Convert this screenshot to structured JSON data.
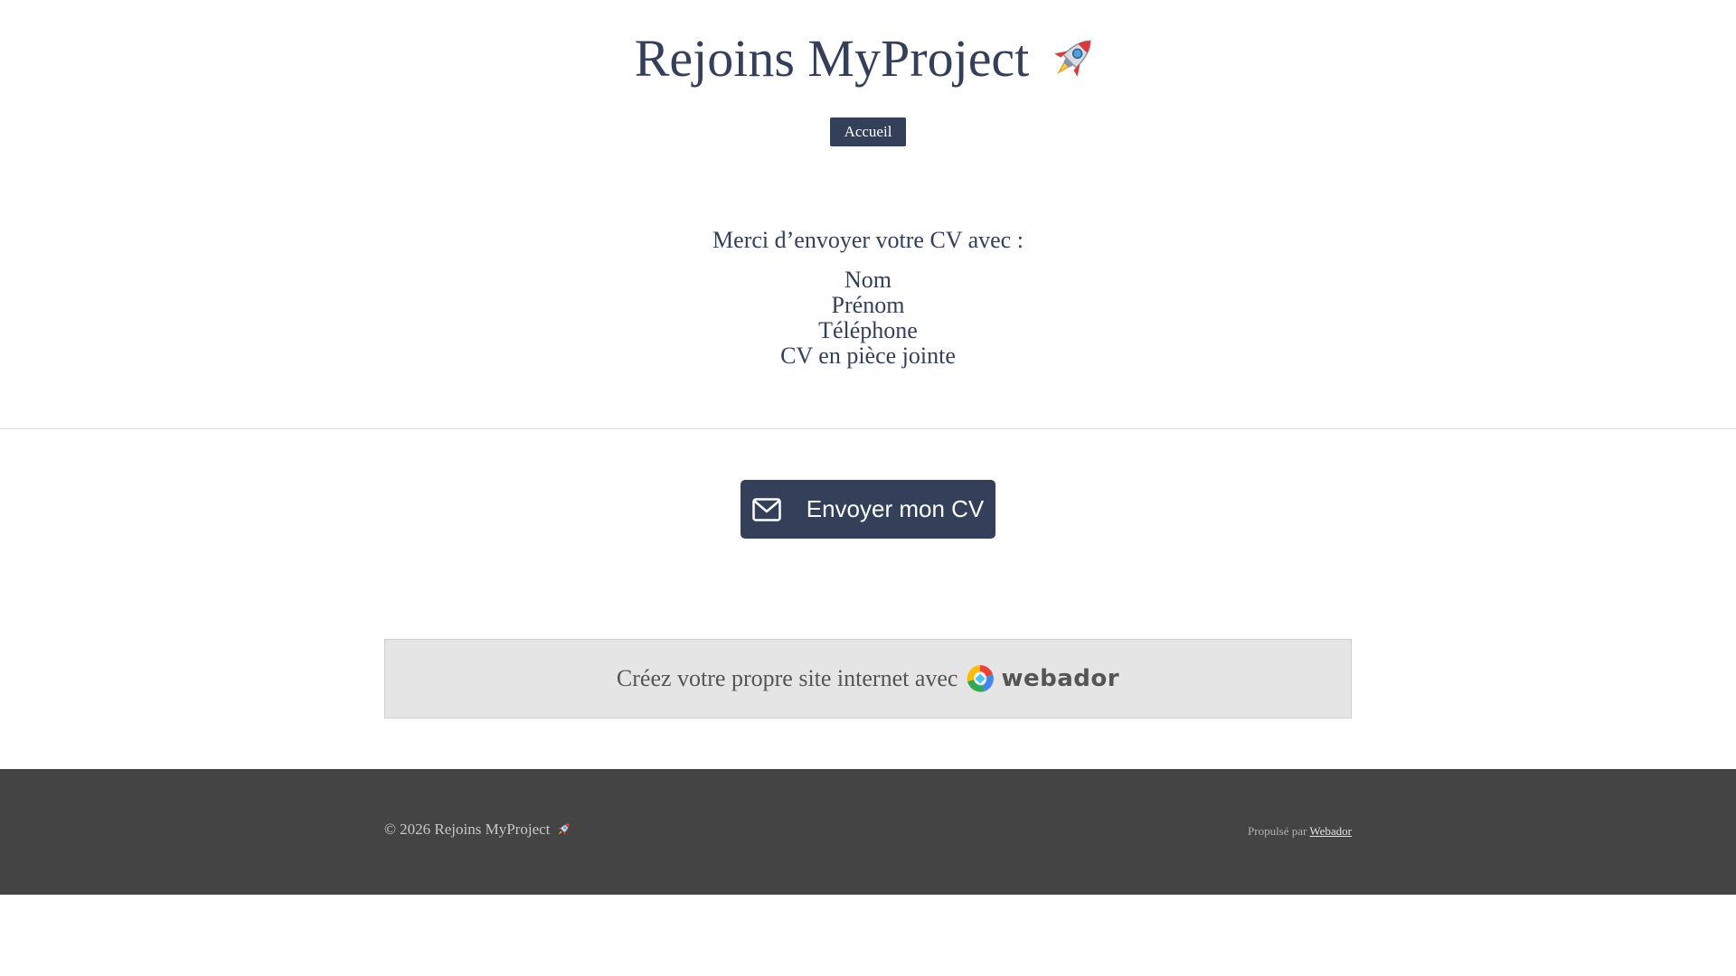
{
  "header": {
    "title": "Rejoins MyProject",
    "title_icon": "rocket-icon",
    "nav": [
      {
        "label": "Accueil"
      }
    ]
  },
  "content": {
    "intro": "Merci d’envoyer votre CV avec :",
    "fields": [
      "Nom",
      "Prénom",
      "Téléphone",
      "CV en pièce jointe"
    ],
    "send_button": {
      "label": "Envoyer mon CV",
      "icon": "mail-icon"
    }
  },
  "banner": {
    "text": "Créez votre propre site internet avec",
    "logo_text": "webador",
    "logo_icon": "webador-logo-icon"
  },
  "footer": {
    "copyright": "© 2026 Rejoins MyProject",
    "powered_prefix": "Propulsé par",
    "powered_link": "Webador"
  },
  "colors": {
    "primary": "#34405a",
    "footer_bg": "#444444",
    "banner_bg": "#e5e5e5"
  }
}
